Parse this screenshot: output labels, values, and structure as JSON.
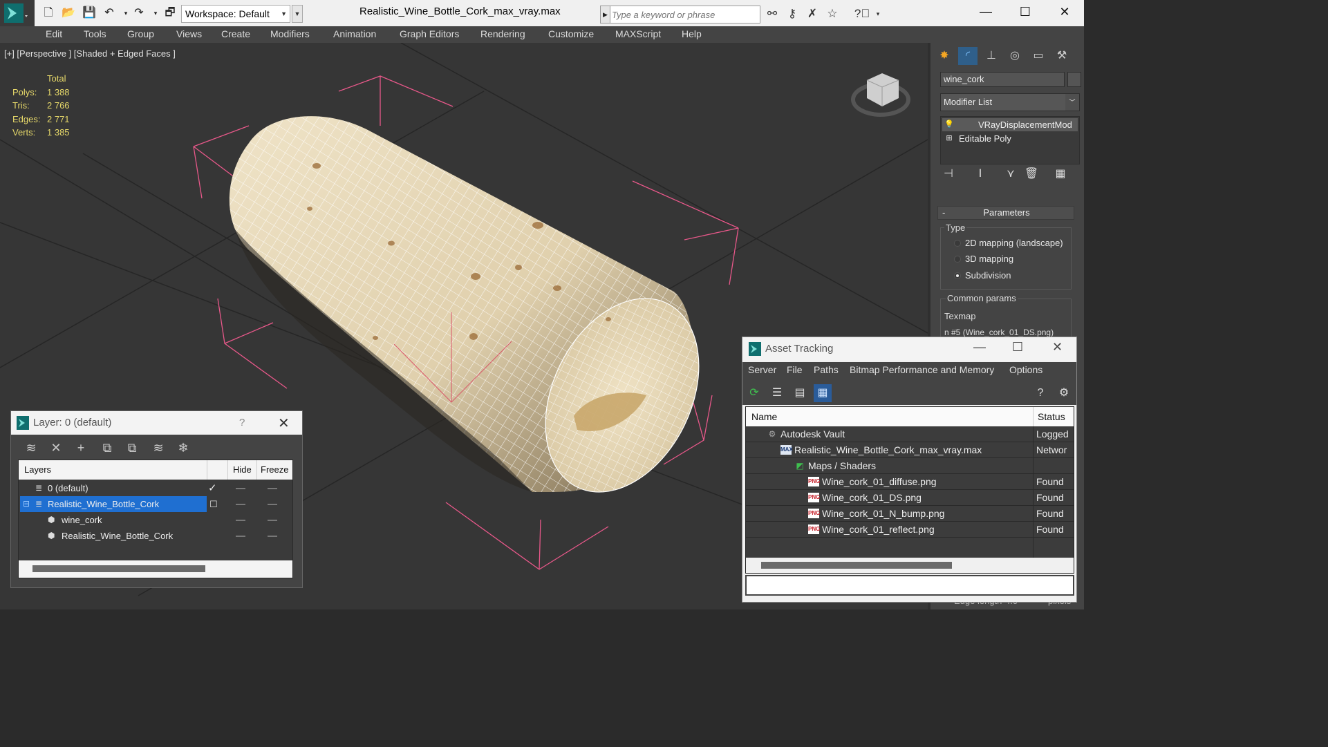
{
  "titlebar": {
    "workspace": "Workspace: Default",
    "file_title": "Realistic_Wine_Bottle_Cork_max_vray.max",
    "search_placeholder": "Type a keyword or phrase"
  },
  "menu": [
    "Edit",
    "Tools",
    "Group",
    "Views",
    "Create",
    "Modifiers",
    "Animation",
    "Graph Editors",
    "Rendering",
    "Customize",
    "MAXScript",
    "Help"
  ],
  "viewport": {
    "label": "[+] [Perspective ] [Shaded + Edged Faces ]",
    "stats": {
      "header": "Total",
      "rows": [
        {
          "key": "Polys:",
          "value": "1 388"
        },
        {
          "key": "Tris:",
          "value": "2 766"
        },
        {
          "key": "Edges:",
          "value": "2 771"
        },
        {
          "key": "Verts:",
          "value": "1 385"
        }
      ]
    }
  },
  "command_panel": {
    "object_name": "wine_cork",
    "modifier_list": "Modifier List",
    "stack": [
      "VRayDisplacementMod",
      "Editable Poly"
    ],
    "parameters_title": "Parameters",
    "type_group": "Type",
    "type_options": [
      {
        "label": "2D mapping (landscape)",
        "selected": false
      },
      {
        "label": "3D mapping",
        "selected": false
      },
      {
        "label": "Subdivision",
        "selected": true
      }
    ],
    "common_params": "Common params",
    "texmap_label": "Texmap",
    "texmap_value": "n #5 (Wine_cork_01_DS.png)",
    "edge_length_label": "Edge length",
    "edge_length_value": "4.0",
    "pixels_label": "pixels"
  },
  "layer_dialog": {
    "title": "Layer: 0 (default)",
    "help": "?",
    "columns": [
      "Layers",
      "Hide",
      "Freeze"
    ],
    "rows": [
      {
        "name": "0 (default)",
        "checked": true
      },
      {
        "name": "Realistic_Wine_Bottle_Cork",
        "selected": true
      },
      {
        "name": "wine_cork"
      },
      {
        "name": "Realistic_Wine_Bottle_Cork"
      }
    ]
  },
  "asset_tracking": {
    "title": "Asset Tracking",
    "menu": [
      "Server",
      "File",
      "Paths",
      "Bitmap Performance and Memory",
      "Options"
    ],
    "columns": [
      "Name",
      "Status"
    ],
    "rows": [
      {
        "name": "Autodesk Vault",
        "status": "Logged"
      },
      {
        "name": "Realistic_Wine_Bottle_Cork_max_vray.max",
        "status": "Networ"
      },
      {
        "name": "Maps / Shaders",
        "status": ""
      },
      {
        "name": "Wine_cork_01_diffuse.png",
        "status": "Found"
      },
      {
        "name": "Wine_cork_01_DS.png",
        "status": "Found"
      },
      {
        "name": "Wine_cork_01_N_bump.png",
        "status": "Found"
      },
      {
        "name": "Wine_cork_01_reflect.png",
        "status": "Found"
      }
    ]
  },
  "colors": {
    "viewport_bg": "#363636",
    "stats_yellow": "#e7d96a",
    "selection_blue": "#1f6fd1",
    "bbox_pink": "#e8588a"
  }
}
